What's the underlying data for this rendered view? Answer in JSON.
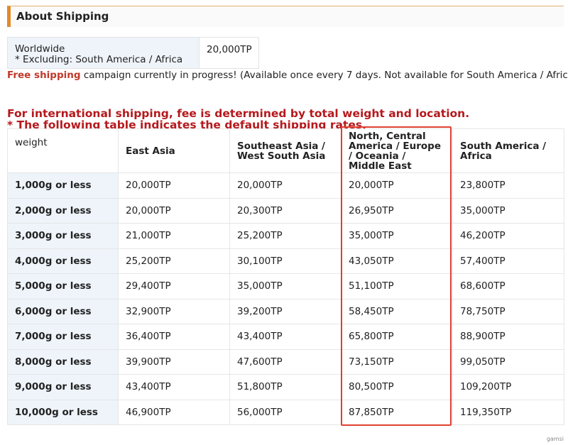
{
  "section": {
    "title": "About Shipping"
  },
  "worldwide": {
    "label_line1": "Worldwide",
    "label_line2": "* Excluding: South America / Africa",
    "fee": "20,000TP"
  },
  "campaign": {
    "highlight": "Free shipping",
    "text": " campaign currently in progress! (Available once every 7 days. Not available for South America / Africa)"
  },
  "intl_note": {
    "line1": "For international shipping, fee is determined by total weight and location.",
    "line2": "* The following table indicates the default shipping rates."
  },
  "table": {
    "headers": [
      "weight",
      "East Asia",
      "Southeast Asia / West South Asia",
      "North, Central America / Europe / Oceania / Middle East",
      "South America / Africa"
    ],
    "rows": [
      [
        "1,000g or less",
        "20,000TP",
        "20,000TP",
        "20,000TP",
        "23,800TP"
      ],
      [
        "2,000g or less",
        "20,000TP",
        "20,300TP",
        "26,950TP",
        "35,000TP"
      ],
      [
        "3,000g or less",
        "21,000TP",
        "25,200TP",
        "35,000TP",
        "46,200TP"
      ],
      [
        "4,000g or less",
        "25,200TP",
        "30,100TP",
        "43,050TP",
        "57,400TP"
      ],
      [
        "5,000g or less",
        "29,400TP",
        "35,000TP",
        "51,100TP",
        "68,600TP"
      ],
      [
        "6,000g or less",
        "32,900TP",
        "39,200TP",
        "58,450TP",
        "78,750TP"
      ],
      [
        "7,000g or less",
        "36,400TP",
        "43,400TP",
        "65,800TP",
        "88,900TP"
      ],
      [
        "8,000g or less",
        "39,900TP",
        "47,600TP",
        "73,150TP",
        "99,050TP"
      ],
      [
        "9,000g or less",
        "43,400TP",
        "51,800TP",
        "80,500TP",
        "109,200TP"
      ],
      [
        "10,000g or less",
        "46,900TP",
        "56,000TP",
        "87,850TP",
        "119,350TP"
      ]
    ]
  },
  "watermark": "gamsi",
  "colors": {
    "accent_bar": "#e08a2a",
    "highlight_border": "#e04030",
    "note_red": "#b5191d"
  }
}
